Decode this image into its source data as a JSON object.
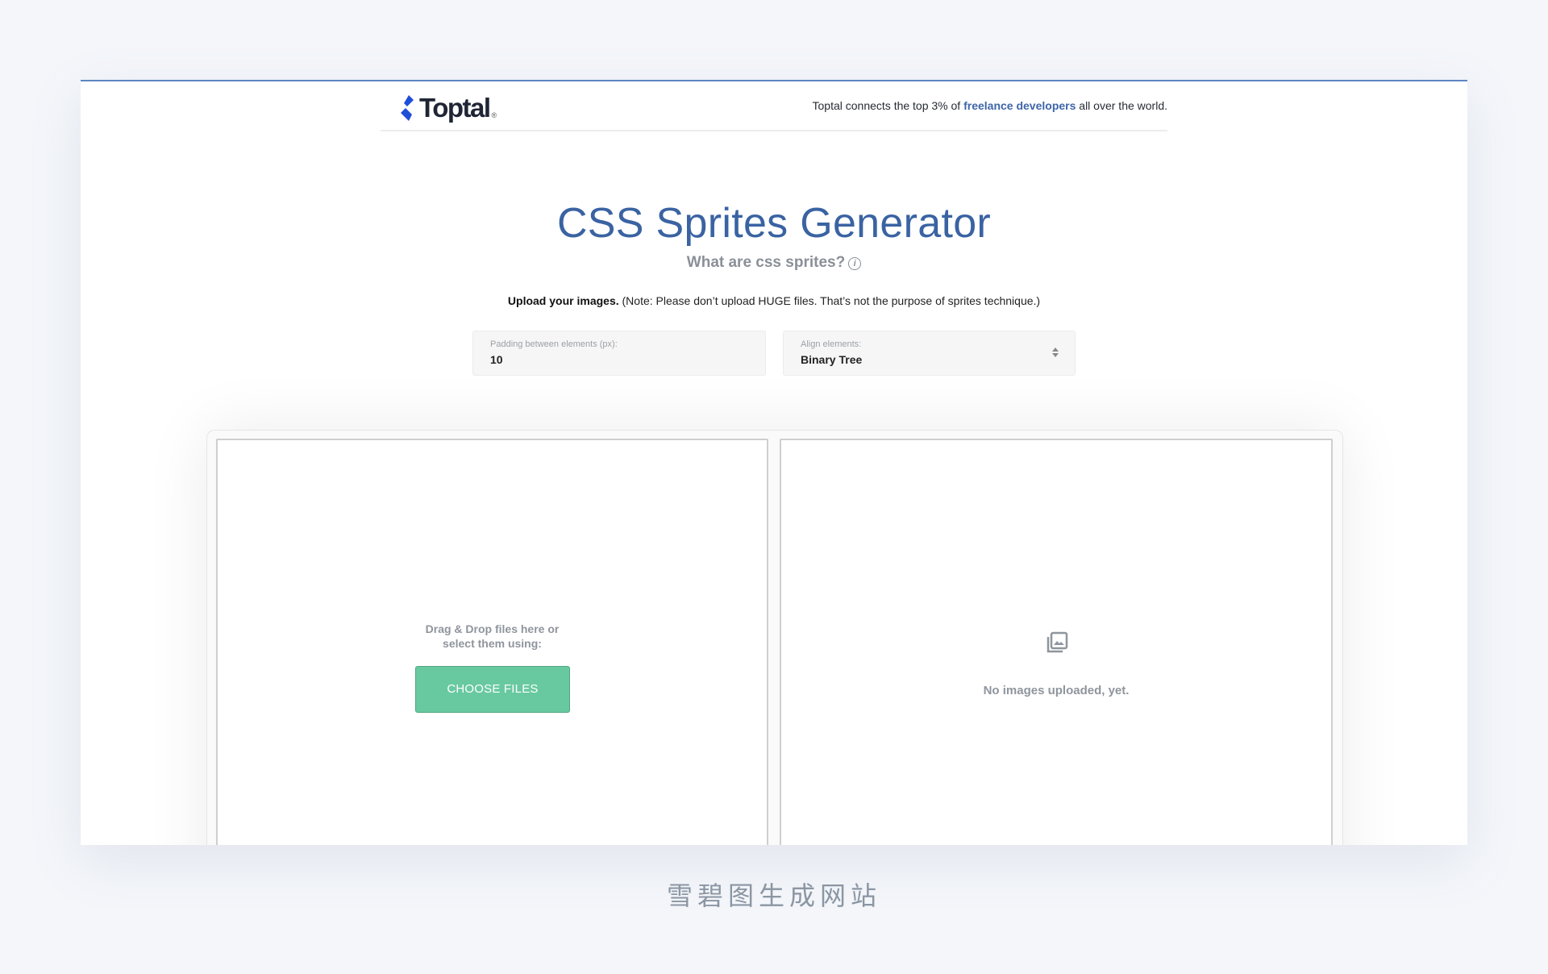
{
  "header": {
    "logo_text": "Toptal",
    "logo_reg": "®",
    "tagline_prefix": "Toptal connects the top 3% of ",
    "tagline_link": "freelance developers",
    "tagline_suffix": " all over the world."
  },
  "main": {
    "title": "CSS Sprites Generator",
    "subtitle": "What are css sprites?",
    "info_icon": "i",
    "note_bold": "Upload your images.",
    "note_text": " (Note: Please don’t upload HUGE files. That’s not the purpose of sprites technique.)"
  },
  "settings": {
    "padding": {
      "label": "Padding between elements (px):",
      "value": "10"
    },
    "align": {
      "label": "Align elements:",
      "value": "Binary Tree"
    }
  },
  "upload": {
    "drop_text_line1": "Drag & Drop files here or",
    "drop_text_line2": "select them using:",
    "choose_button": "CHOOSE FILES"
  },
  "preview": {
    "icon": "images-icon",
    "empty_text": "No images uploaded, yet."
  },
  "caption": "雪碧图生成网站",
  "colors": {
    "brand_blue": "#3a63a2",
    "link_blue": "#3e66a8",
    "button_green": "#68c9a0",
    "muted_gray": "#8f959d"
  }
}
